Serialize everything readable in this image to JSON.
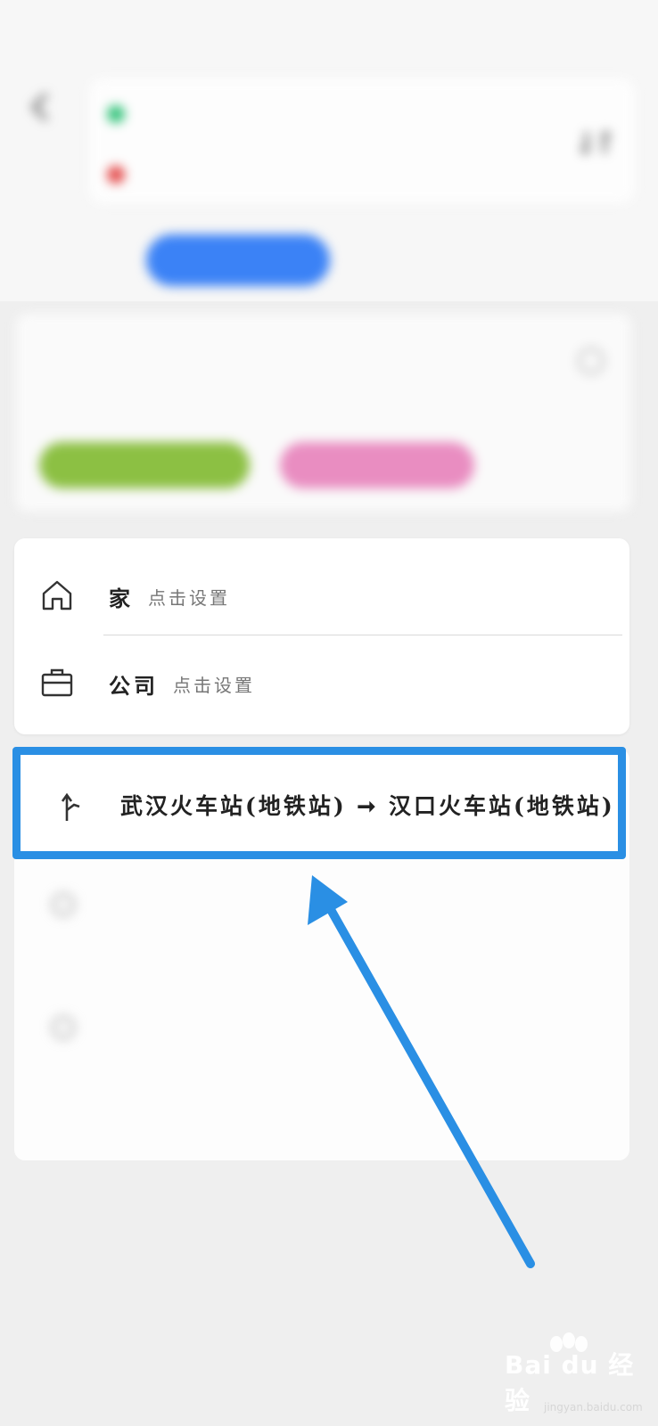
{
  "status_bar": {
    "left": "",
    "right": ""
  },
  "route": {
    "start": "",
    "end": ""
  },
  "mode_tabs": {
    "drive": "",
    "transit": "",
    "walk": "",
    "ride": ""
  },
  "commute": {
    "title": "",
    "route": "",
    "tag_green": "",
    "tag_pink": ""
  },
  "places": {
    "home": {
      "label": "家",
      "hint": "点击设置"
    },
    "company": {
      "label": "公司",
      "hint": "点击设置"
    }
  },
  "history": {
    "highlight_route": "武汉火车站(地铁站) ➞ 汉口火车站(地铁站)",
    "row2": "",
    "row3": "",
    "clear": ""
  },
  "colors": {
    "highlight": "#2a8fe4",
    "transit_tab": "#3b82f6"
  },
  "icons": {
    "home": "home-icon",
    "company": "briefcase-icon",
    "history": "route-arrow-icon"
  },
  "watermark": {
    "brand": "Bai du 经验",
    "site": "jingyan.baidu.com"
  }
}
